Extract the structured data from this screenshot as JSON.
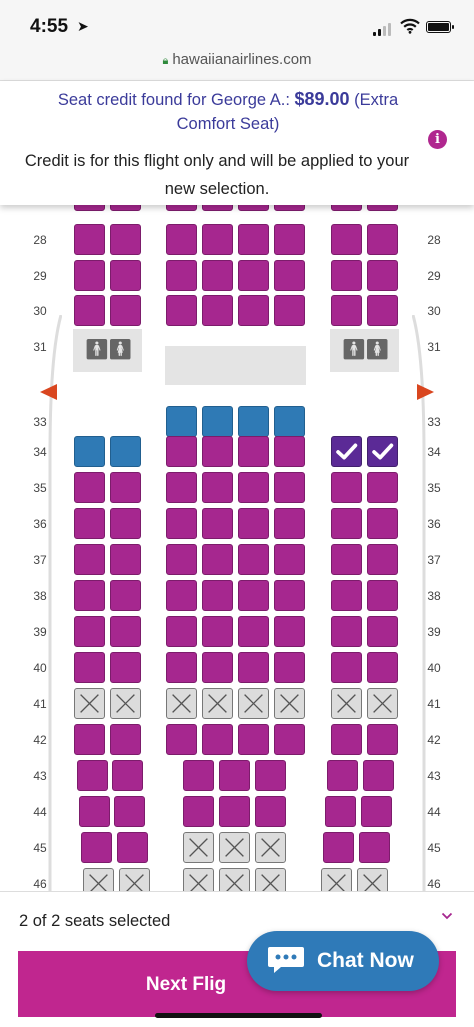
{
  "status_bar": {
    "time": "4:55"
  },
  "url_bar": {
    "url": "hawaiianairlines.com"
  },
  "banner": {
    "credit_prefix": "Seat credit found for George A.: ",
    "credit_amount": "$89.00",
    "credit_suffix": " (Extra Comfort Seat)",
    "note": "Credit is for this flight only and will be applied to your new selection.",
    "info_glyph": "i"
  },
  "seat_map": {
    "legend_icons": [
      "restroom-icon",
      "exit-arrow-icon"
    ],
    "rows": [
      {
        "label": "28",
        "seats": [
          "avail",
          "avail",
          "avail",
          "avail",
          "avail",
          "avail",
          "avail",
          "avail"
        ]
      },
      {
        "label": "29",
        "seats": [
          "avail",
          "avail",
          "avail",
          "avail",
          "avail",
          "avail",
          "avail",
          "avail"
        ]
      },
      {
        "label": "30",
        "seats": [
          "avail",
          "avail",
          "avail",
          "avail",
          "avail",
          "avail",
          "avail",
          "avail"
        ]
      },
      {
        "label": "31",
        "seats": []
      },
      {
        "label": "33",
        "seats": [
          null,
          null,
          "comfort",
          "comfort",
          "comfort",
          "comfort",
          null,
          null
        ]
      },
      {
        "label": "34",
        "seats": [
          "comfort",
          "comfort",
          "avail",
          "avail",
          "avail",
          "avail",
          "selected",
          "selected"
        ]
      },
      {
        "label": "35",
        "seats": [
          "avail",
          "avail",
          "avail",
          "avail",
          "avail",
          "avail",
          "avail",
          "avail"
        ]
      },
      {
        "label": "36",
        "seats": [
          "avail",
          "avail",
          "avail",
          "avail",
          "avail",
          "avail",
          "avail",
          "avail"
        ]
      },
      {
        "label": "37",
        "seats": [
          "avail",
          "avail",
          "avail",
          "avail",
          "avail",
          "avail",
          "avail",
          "avail"
        ]
      },
      {
        "label": "38",
        "seats": [
          "avail",
          "avail",
          "avail",
          "avail",
          "avail",
          "avail",
          "avail",
          "avail"
        ]
      },
      {
        "label": "39",
        "seats": [
          "avail",
          "avail",
          "avail",
          "avail",
          "avail",
          "avail",
          "avail",
          "avail"
        ]
      },
      {
        "label": "40",
        "seats": [
          "avail",
          "avail",
          "avail",
          "avail",
          "avail",
          "avail",
          "avail",
          "avail"
        ]
      },
      {
        "label": "41",
        "seats": [
          "blocked",
          "blocked",
          "blocked",
          "blocked",
          "blocked",
          "blocked",
          "blocked",
          "blocked"
        ]
      },
      {
        "label": "42",
        "seats": [
          "avail",
          "avail",
          "avail",
          "avail",
          "avail",
          "avail",
          "avail",
          "avail"
        ]
      },
      {
        "label": "43",
        "seats": [
          "avail",
          "avail",
          null,
          "avail",
          "avail",
          "avail",
          "avail",
          "avail"
        ]
      },
      {
        "label": "44",
        "seats": [
          "avail",
          "avail",
          null,
          "avail",
          "avail",
          "avail",
          "avail",
          "avail"
        ]
      },
      {
        "label": "45",
        "seats": [
          "avail",
          "avail",
          null,
          "blocked",
          "blocked",
          "blocked",
          "avail",
          "avail"
        ]
      },
      {
        "label": "46",
        "seats": [
          "blocked",
          "blocked",
          null,
          "blocked",
          "blocked",
          "blocked",
          "blocked",
          "blocked"
        ]
      }
    ]
  },
  "colors": {
    "available": "#a6278f",
    "extra_comfort": "#2f7ab5",
    "selected": "#5b2a96",
    "unavailable": "#dcdcdc",
    "exit": "#d9461f",
    "brand": "#c0268f"
  },
  "footer": {
    "selection_status": "2 of 2 seats selected",
    "next_button": "Next Flig",
    "chat_label": "Chat Now"
  }
}
